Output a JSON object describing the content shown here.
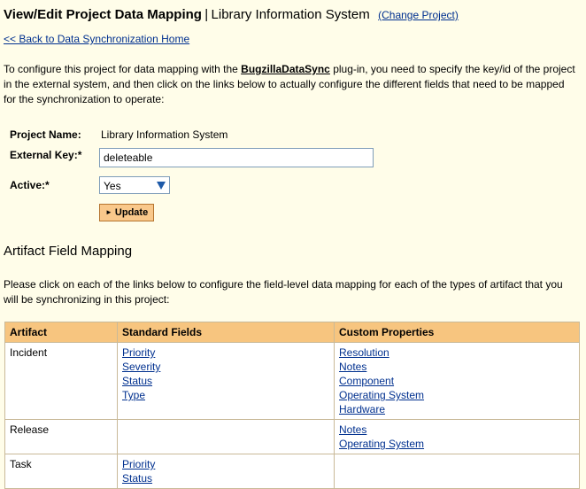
{
  "header": {
    "title": "View/Edit Project Data Mapping",
    "separator": "|",
    "project_name": "Library Information System",
    "change_project_link": "(Change Project)"
  },
  "back_link": "<< Back to Data Synchronization Home",
  "intro": {
    "part1": "To configure this project for data mapping with the ",
    "plugin_name": "BugzillaDataSync",
    "part2": " plug-in, you need to specify the key/id of the project in the external system, and then click on the links below to actually configure the different fields that need to be mapped for the synchronization to operate:"
  },
  "form": {
    "project_name_label": "Project Name:",
    "project_name_value": "Library Information System",
    "external_key_label": "External Key:*",
    "external_key_value": "deleteable",
    "active_label": "Active:*",
    "active_value": "Yes",
    "update_button": "Update"
  },
  "artifact_section": {
    "heading": "Artifact Field Mapping",
    "description": "Please click on each of the links below to configure the field-level data mapping for each of the types of artifact that you will be synchronizing in this project:"
  },
  "table": {
    "headers": [
      "Artifact",
      "Standard Fields",
      "Custom Properties"
    ],
    "rows": [
      {
        "artifact": "Incident",
        "standard_fields": [
          "Priority",
          "Severity",
          "Status",
          "Type"
        ],
        "custom_properties": [
          "Resolution",
          "Notes",
          "Component",
          "Operating System",
          "Hardware"
        ]
      },
      {
        "artifact": "Release",
        "standard_fields": [],
        "custom_properties": [
          "Notes",
          "Operating System"
        ]
      },
      {
        "artifact": "Task",
        "standard_fields": [
          "Priority",
          "Status"
        ],
        "custom_properties": []
      }
    ]
  }
}
